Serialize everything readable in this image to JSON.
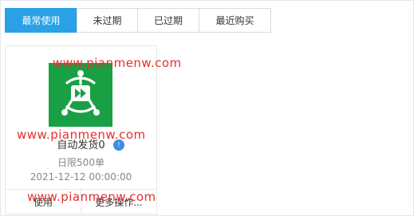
{
  "tabs": [
    {
      "label": "最常使用",
      "active": true
    },
    {
      "label": "未过期",
      "active": false
    },
    {
      "label": "已过期",
      "active": false
    },
    {
      "label": "最近购买",
      "active": false
    }
  ],
  "card": {
    "icon": "robot-fast-forward-icon",
    "title": "自动发货0",
    "badge": "!",
    "limit": "日限500单",
    "date": "2021-12-12 00:00:00",
    "actions": [
      "使用",
      "更多操作..."
    ]
  },
  "watermark": "www.pianmenw.com",
  "colors": {
    "accent": "#2aa1e6",
    "logo_bg": "#19a045",
    "badge": "#3b8fe3",
    "watermark": "#e5302a"
  }
}
